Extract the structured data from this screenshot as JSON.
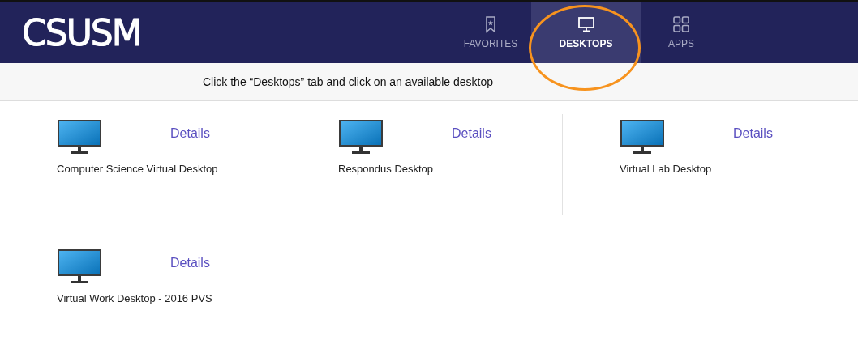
{
  "header": {
    "logo": "CSUSM",
    "tabs": [
      {
        "label": "FAVORITES",
        "kind": "bookmark",
        "selected": false
      },
      {
        "label": "DESKTOPS",
        "kind": "monitor",
        "selected": true
      },
      {
        "label": "APPS",
        "kind": "grid",
        "selected": false
      }
    ],
    "annotation": {
      "kind": "ellipse",
      "color": "#f7931e"
    }
  },
  "instruction": "Click the “Desktops” tab and click on an available desktop",
  "desktops": [
    {
      "name": "Computer Science Virtual Desktop",
      "action": "Details"
    },
    {
      "name": "Respondus Desktop",
      "action": "Details"
    },
    {
      "name": "Virtual Lab Desktop",
      "action": "Details"
    },
    {
      "name": "Virtual Work Desktop - 2016 PVS",
      "action": "Details"
    }
  ]
}
